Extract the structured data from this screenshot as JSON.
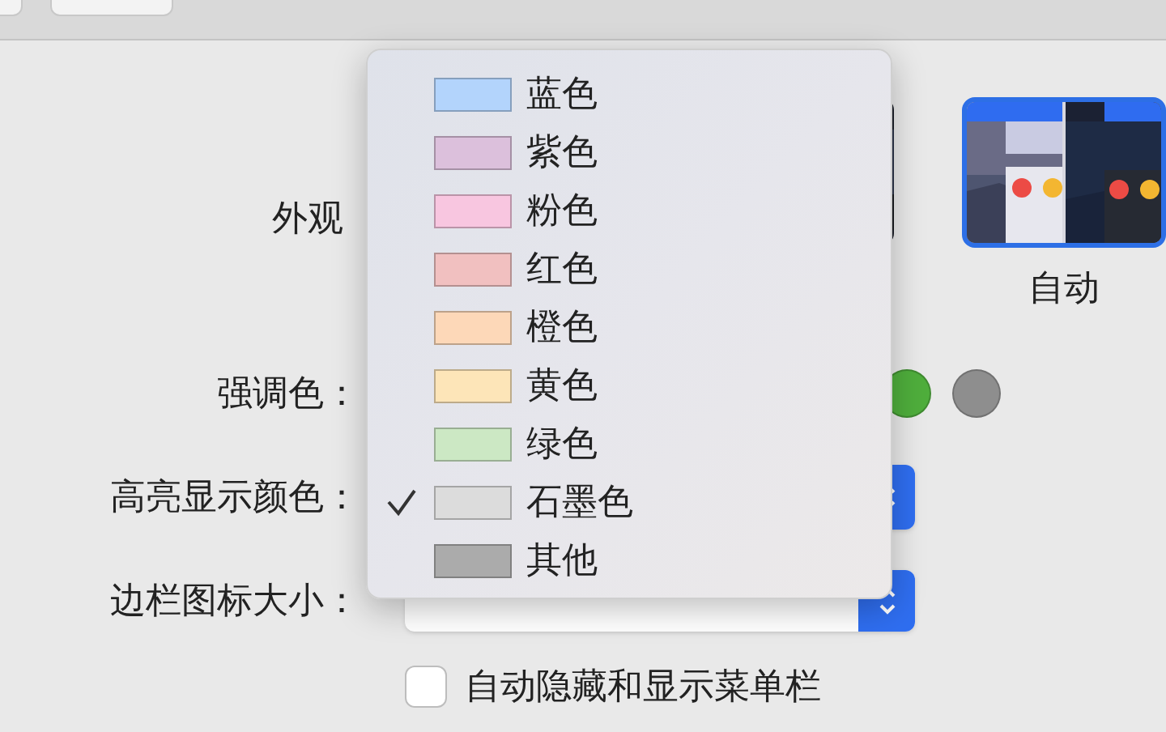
{
  "appearance": {
    "label": "外观",
    "options": [
      {
        "label": "自动",
        "selected": true
      }
    ]
  },
  "accent_color": {
    "label": "强调色：",
    "swatches": [
      {
        "color": "#4fae3c",
        "selected": false
      },
      {
        "color": "#8e8e8e",
        "selected": false
      }
    ]
  },
  "highlight_color": {
    "label": "高亮显示颜色："
  },
  "sidebar_icon_size": {
    "label": "边栏图标大小："
  },
  "menu_bar_checkbox": {
    "label": "自动隐藏和显示菜单栏",
    "checked": false
  },
  "highlight_menu": {
    "items": [
      {
        "label": "蓝色",
        "color": "#b3d4fc",
        "selected": false
      },
      {
        "label": "紫色",
        "color": "#dcc0dc",
        "selected": false
      },
      {
        "label": "粉色",
        "color": "#f8c6e0",
        "selected": false
      },
      {
        "label": "红色",
        "color": "#f1c0c0",
        "selected": false
      },
      {
        "label": "橙色",
        "color": "#fdd8b8",
        "selected": false
      },
      {
        "label": "黄色",
        "color": "#fde5b8",
        "selected": false
      },
      {
        "label": "绿色",
        "color": "#cce8c4",
        "selected": false
      },
      {
        "label": "石墨色",
        "color": "#dcdcdc",
        "selected": true
      },
      {
        "label": "其他",
        "color": "#ababab",
        "selected": false
      }
    ]
  }
}
